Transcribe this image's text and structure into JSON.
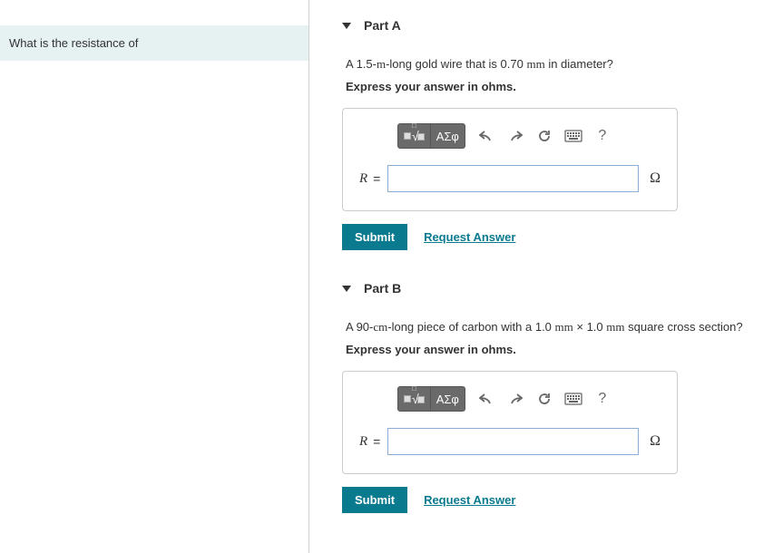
{
  "prompt": "What is the resistance of",
  "parts": {
    "a": {
      "title": "Part A",
      "question_pre": "A 1.5-",
      "question_unit1": "m",
      "question_mid": "-long gold wire that is 0.70 ",
      "question_unit2": "mm",
      "question_post": " in diameter?",
      "instruction": "Express your answer in ohms.",
      "variable": "R",
      "equals": "=",
      "unit": "Ω",
      "input_value": ""
    },
    "b": {
      "title": "Part B",
      "question_pre": "A 90-",
      "question_unit1": "cm",
      "question_mid": "-long piece of carbon with a 1.0 ",
      "question_unit2": "mm",
      "question_mid2": " × 1.0 ",
      "question_unit3": "mm",
      "question_post": " square cross section?",
      "instruction": "Express your answer in ohms.",
      "variable": "R",
      "equals": "=",
      "unit": "Ω",
      "input_value": ""
    }
  },
  "toolbar": {
    "templates_label": "templates",
    "symbols_label": "ΑΣφ",
    "undo": "undo",
    "redo": "redo",
    "reset": "reset",
    "keyboard": "keyboard",
    "help": "?"
  },
  "actions": {
    "submit": "Submit",
    "request": "Request Answer"
  }
}
